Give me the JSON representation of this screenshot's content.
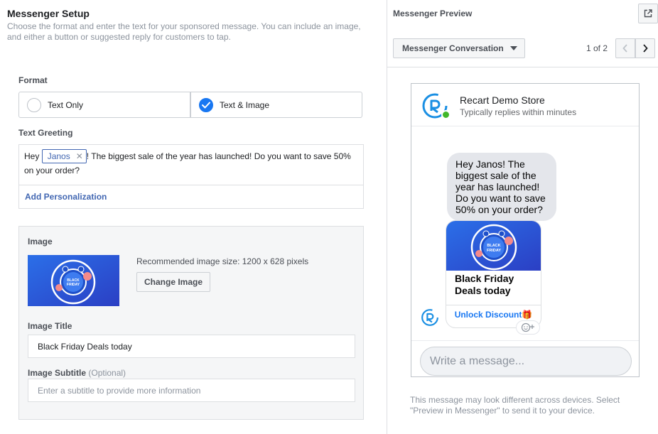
{
  "setup": {
    "title": "Messenger Setup",
    "description": "Choose the format and enter the text for your sponsored message. You can include an image, and either a button or suggested reply for customers to tap.",
    "format_label": "Format",
    "formats": [
      {
        "label": "Text Only",
        "selected": false
      },
      {
        "label": "Text & Image",
        "selected": true
      }
    ],
    "greeting_label": "Text Greeting",
    "greeting": {
      "prefix": "Hey ",
      "chip": "Janos",
      "suffix": "! The biggest sale of the year has launched! Do you want to save 50% on your order?"
    },
    "add_personalization": "Add Personalization",
    "image": {
      "label": "Image",
      "recommended": "Recommended image size: 1200 x 628 pixels",
      "change_button": "Change Image",
      "title_label": "Image Title",
      "title_value": "Black Friday Deals today",
      "subtitle_label": "Image Subtitle",
      "subtitle_optional": "(Optional)",
      "subtitle_placeholder": "Enter a subtitle to provide more information"
    }
  },
  "preview": {
    "title": "Messenger Preview",
    "conversation_dropdown": "Messenger Conversation",
    "pager": "1 of 2",
    "store_name": "Recart Demo Store",
    "store_status": "Typically replies within minutes",
    "message": "Hey Janos! The biggest sale of the year has launched! Do you want to save 50% on your order?",
    "card_title": "Black Friday Deals today",
    "card_button": "Unlock Discount🎁",
    "compose_placeholder": "Write a message...",
    "disclaimer": "This message may look different across devices. Select \"Preview in Messenger\" to send it to your device."
  },
  "colors": {
    "accent": "#1877f2",
    "link": "#4267b2",
    "online": "#42b72a",
    "banner": "#2d5ad6"
  },
  "icons": [
    "check-icon",
    "close-icon",
    "external-link-icon",
    "caret-down-icon",
    "chevron-left-icon",
    "chevron-right-icon",
    "recart-logo",
    "emoji-reaction-icon"
  ]
}
